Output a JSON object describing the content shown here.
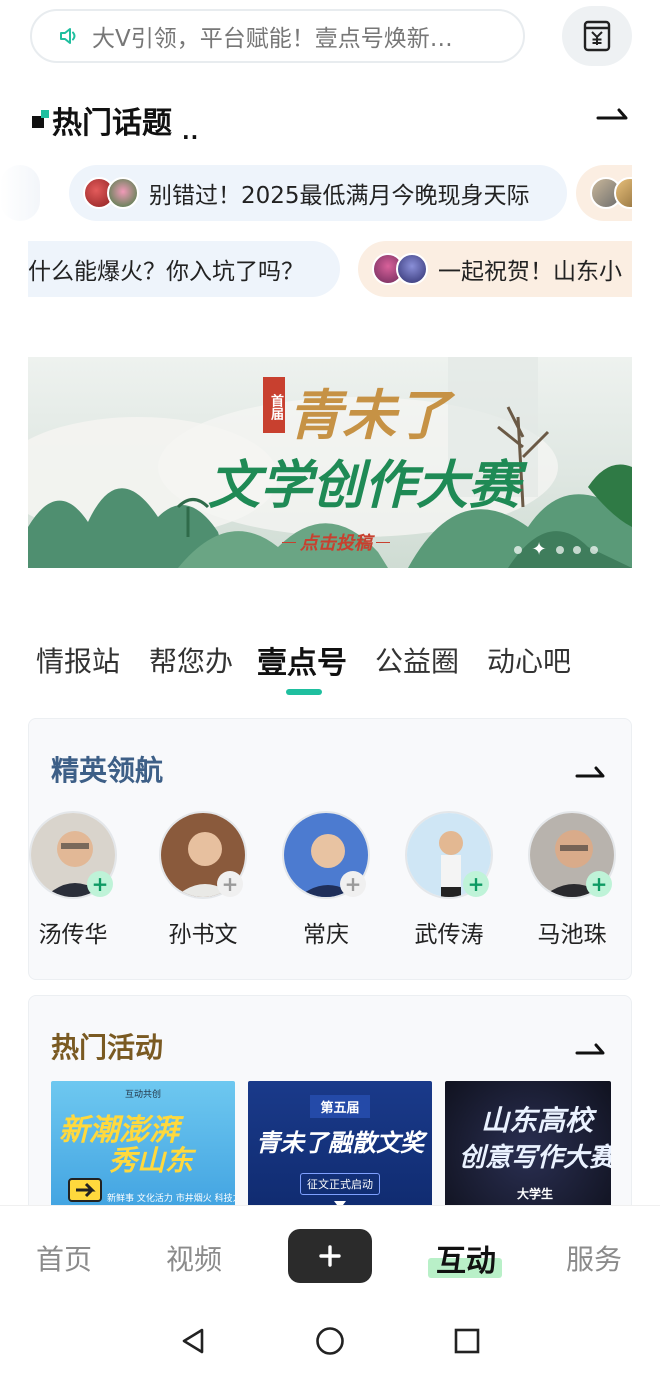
{
  "search": {
    "placeholder": "大V引领，平台赋能！壹点号焕新…"
  },
  "hot_topics": {
    "title": "热门话题",
    "row1": [
      {
        "text": "别错过！2025最低满月今晚现身天际"
      }
    ],
    "row2": [
      {
        "text": "什么能爆火？你入坑了吗？"
      },
      {
        "text": "一起祝贺！山东小"
      }
    ]
  },
  "banner": {
    "badge": "首届",
    "brand": "青未了",
    "title": "文学创作大赛",
    "cta": "点击投稿",
    "slides": 5,
    "active_slide": 1
  },
  "tabs": [
    {
      "label": "情报站",
      "active": false
    },
    {
      "label": "帮您办",
      "active": false
    },
    {
      "label": "壹点号",
      "active": true
    },
    {
      "label": "公益圈",
      "active": false
    },
    {
      "label": "动心吧",
      "active": false
    }
  ],
  "elite": {
    "title": "精英领航",
    "title_color": "#3d5f87",
    "people": [
      {
        "name": "汤传华",
        "followed": false
      },
      {
        "name": "孙书文",
        "followed": true
      },
      {
        "name": "常庆",
        "followed": true
      },
      {
        "name": "武传涛",
        "followed": false
      },
      {
        "name": "马池珠",
        "followed": false
      }
    ]
  },
  "activities": {
    "title": "热门活动",
    "title_color": "#7a5a22",
    "items": [
      {
        "top": "互动共创",
        "title1": "新潮澎湃",
        "title2": "秀山东",
        "tags": "新鲜事 文化活力 市井烟火 科技力量"
      },
      {
        "top": "第五届",
        "title1": "青未了融散文奖",
        "sub": "征文正式启动"
      },
      {
        "title1": "山东高校",
        "title2": "创意写作大赛",
        "sub": "大学生"
      }
    ]
  },
  "bottom_nav": {
    "items": [
      {
        "label": "首页",
        "active": false
      },
      {
        "label": "视频",
        "active": false
      },
      {
        "label": "互动",
        "active": true
      },
      {
        "label": "服务",
        "active": false
      }
    ],
    "plus": "+"
  },
  "colors": {
    "accent": "#1fbf9f",
    "nav_highlight": "#b9f0c8"
  }
}
